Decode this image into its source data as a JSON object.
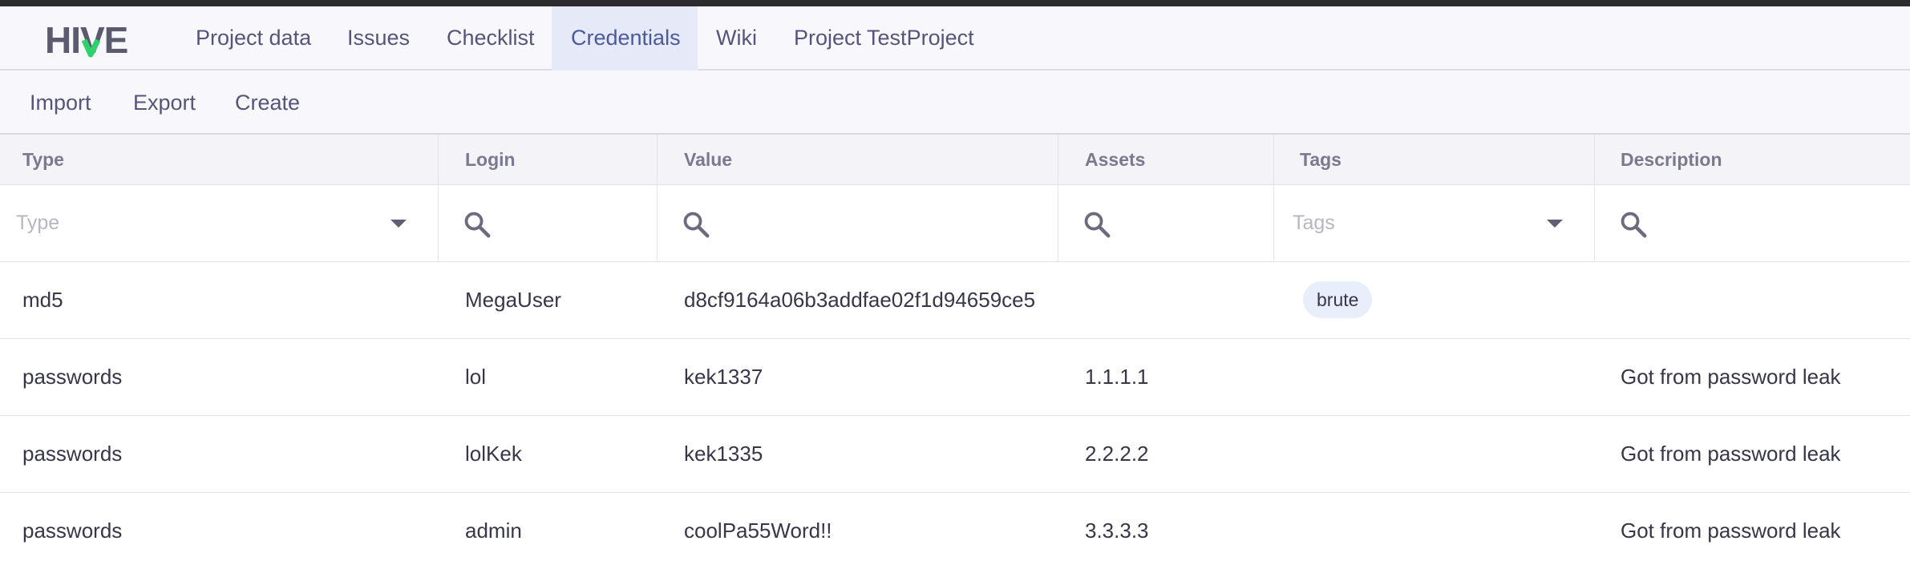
{
  "app": {
    "logo_text": "HIVE",
    "brand_accent": "#2fd16a"
  },
  "nav": {
    "tabs": [
      {
        "label": "Project data",
        "active": false
      },
      {
        "label": "Issues",
        "active": false
      },
      {
        "label": "Checklist",
        "active": false
      },
      {
        "label": "Credentials",
        "active": true
      },
      {
        "label": "Wiki",
        "active": false
      },
      {
        "label": "Project TestProject",
        "active": false
      }
    ]
  },
  "toolbar": {
    "import_label": "Import",
    "export_label": "Export",
    "create_label": "Create"
  },
  "table": {
    "columns": [
      "Type",
      "Login",
      "Value",
      "Assets",
      "Tags",
      "Description"
    ],
    "filters": {
      "type_placeholder": "Type",
      "tags_placeholder": "Tags"
    },
    "rows": [
      {
        "type": "md5",
        "login": "MegaUser",
        "value": "d8cf9164a06b3addfae02f1d94659ce5",
        "assets": "",
        "tags": "brute",
        "description": ""
      },
      {
        "type": "passwords",
        "login": "lol",
        "value": "kek1337",
        "assets": "1.1.1.1",
        "tags": "",
        "description": "Got from password leak"
      },
      {
        "type": "passwords",
        "login": "lolKek",
        "value": "kek1335",
        "assets": "2.2.2.2",
        "tags": "",
        "description": "Got from password leak"
      },
      {
        "type": "passwords",
        "login": "admin",
        "value": "coolPa55Word!!",
        "assets": "3.3.3.3",
        "tags": "",
        "description": "Got from password leak"
      }
    ]
  }
}
